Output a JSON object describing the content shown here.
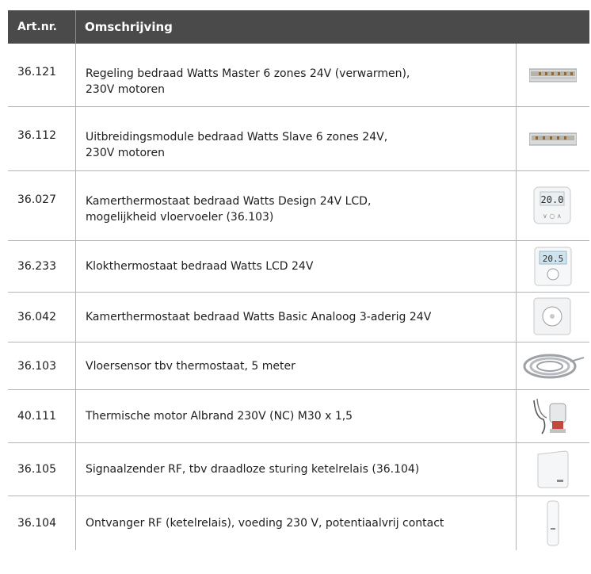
{
  "header": {
    "col_code": "Art.nr.",
    "col_desc": "Omschrijving"
  },
  "rows": [
    {
      "code": "36.121",
      "desc": "Regeling bedraad Watts Master 6 zones 24V (verwarmen),\n230V motoren",
      "icon": "master-controller-image"
    },
    {
      "code": "36.112",
      "desc": "Uitbreidingsmodule bedraad Watts Slave 6 zones 24V,\n230V motoren",
      "icon": "slave-module-image"
    },
    {
      "code": "36.027",
      "desc": "Kamerthermostaat bedraad Watts Design 24V LCD,\nmogelijkheid vloervoeler (36.103)",
      "icon": "design-thermostat-image"
    },
    {
      "code": "36.233",
      "desc": "Klokthermostaat bedraad Watts LCD 24V",
      "icon": "clock-thermostat-image"
    },
    {
      "code": "36.042",
      "desc": "Kamerthermostaat bedraad Watts Basic Analoog 3-aderig 24V",
      "icon": "analog-thermostat-image"
    },
    {
      "code": "36.103",
      "desc": "Vloersensor tbv thermostaat, 5 meter",
      "icon": "floor-sensor-cable-image"
    },
    {
      "code": "40.111",
      "desc": "Thermische motor Albrand 230V (NC) M30 x 1,5",
      "icon": "thermal-motor-image"
    },
    {
      "code": "36.105",
      "desc": "Signaalzender RF, tbv draadloze sturing ketelrelais (36.104)",
      "icon": "rf-transmitter-image"
    },
    {
      "code": "36.104",
      "desc": "Ontvanger RF (ketelrelais), voeding 230 V, potentiaalvrij contact",
      "icon": "rf-receiver-image"
    }
  ],
  "screen_texts": {
    "thermostat_display_1": "20.0",
    "thermostat_display_2": "20.5"
  }
}
